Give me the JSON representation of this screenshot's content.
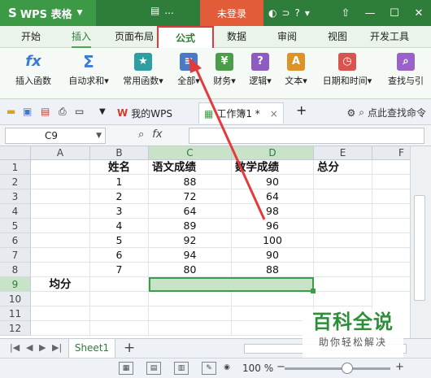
{
  "titlebar": {
    "brand": "WPS 表格",
    "doc_short": "...",
    "login": "未登录"
  },
  "ribbon_tabs": [
    "开始",
    "插入",
    "页面布局",
    "公式",
    "数据",
    "审阅",
    "视图",
    "开发工具"
  ],
  "ribbon_buttons": [
    {
      "label": "插入函数",
      "icon": "fx"
    },
    {
      "label": "自动求和▾",
      "icon": "Σ"
    },
    {
      "label": "常用函数▾",
      "icon": "★"
    },
    {
      "label": "全部▾",
      "icon": "≡"
    },
    {
      "label": "财务▾",
      "icon": "¥"
    },
    {
      "label": "逻辑▾",
      "icon": "?"
    },
    {
      "label": "文本▾",
      "icon": "A"
    },
    {
      "label": "日期和时间▾",
      "icon": "◷"
    },
    {
      "label": "查找与引",
      "icon": "⌕"
    }
  ],
  "docbar": {
    "wps_tab": "我的WPS",
    "book_tab": "工作簿1 *",
    "search_cmd": "点此查找命令"
  },
  "formulabar": {
    "namebox": "C9",
    "fx": "fx"
  },
  "columns": [
    "A",
    "B",
    "C",
    "D",
    "E",
    "F"
  ],
  "rows": [
    "1",
    "2",
    "3",
    "4",
    "5",
    "6",
    "7",
    "8",
    "9",
    "10",
    "11",
    "12"
  ],
  "headers": {
    "name": "姓名",
    "chinese": "语文成绩",
    "math": "数学成绩",
    "total": "总分"
  },
  "table_rows": [
    {
      "name": "1",
      "chinese": "88",
      "math": "90"
    },
    {
      "name": "2",
      "chinese": "72",
      "math": "64"
    },
    {
      "name": "3",
      "chinese": "64",
      "math": "98"
    },
    {
      "name": "4",
      "chinese": "89",
      "math": "96"
    },
    {
      "name": "5",
      "chinese": "92",
      "math": "100"
    },
    {
      "name": "6",
      "chinese": "94",
      "math": "90"
    },
    {
      "name": "7",
      "chinese": "80",
      "math": "88"
    }
  ],
  "avg_label": "均分",
  "sheetbar": {
    "sheet1": "Sheet1"
  },
  "statusbar": {
    "zoom": "100 %"
  },
  "watermark": {
    "main": "百科全说",
    "sub": "助你轻松解决"
  },
  "colors": {
    "accent": "#2f7d3a",
    "highlight": "#e33b3b",
    "selection": "#c9e3c9"
  }
}
